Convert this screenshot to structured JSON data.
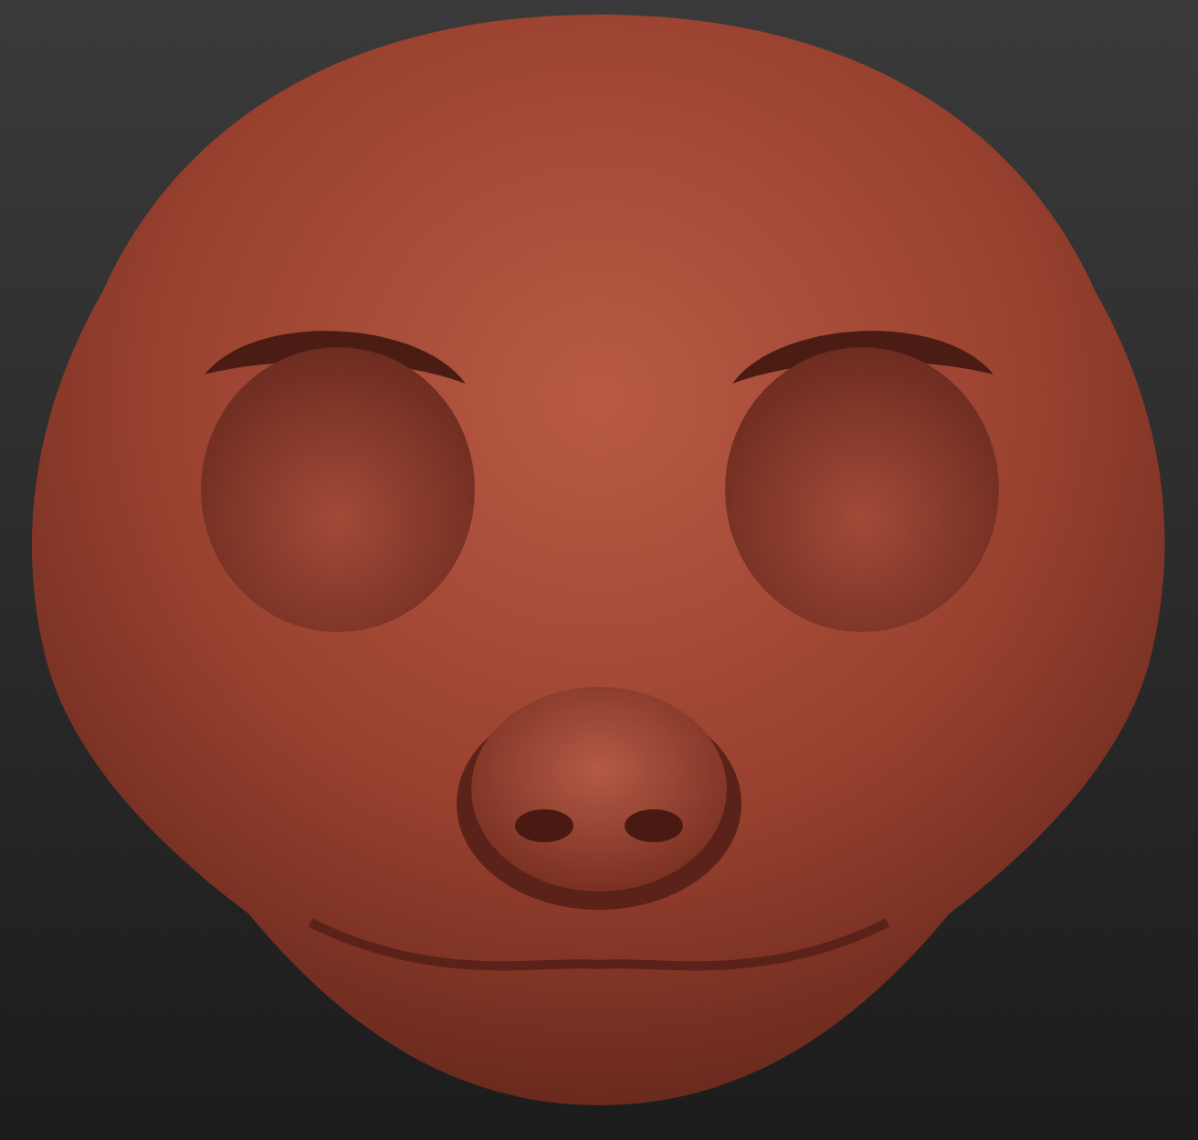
{
  "viewport": {
    "kind": "sculpt"
  }
}
